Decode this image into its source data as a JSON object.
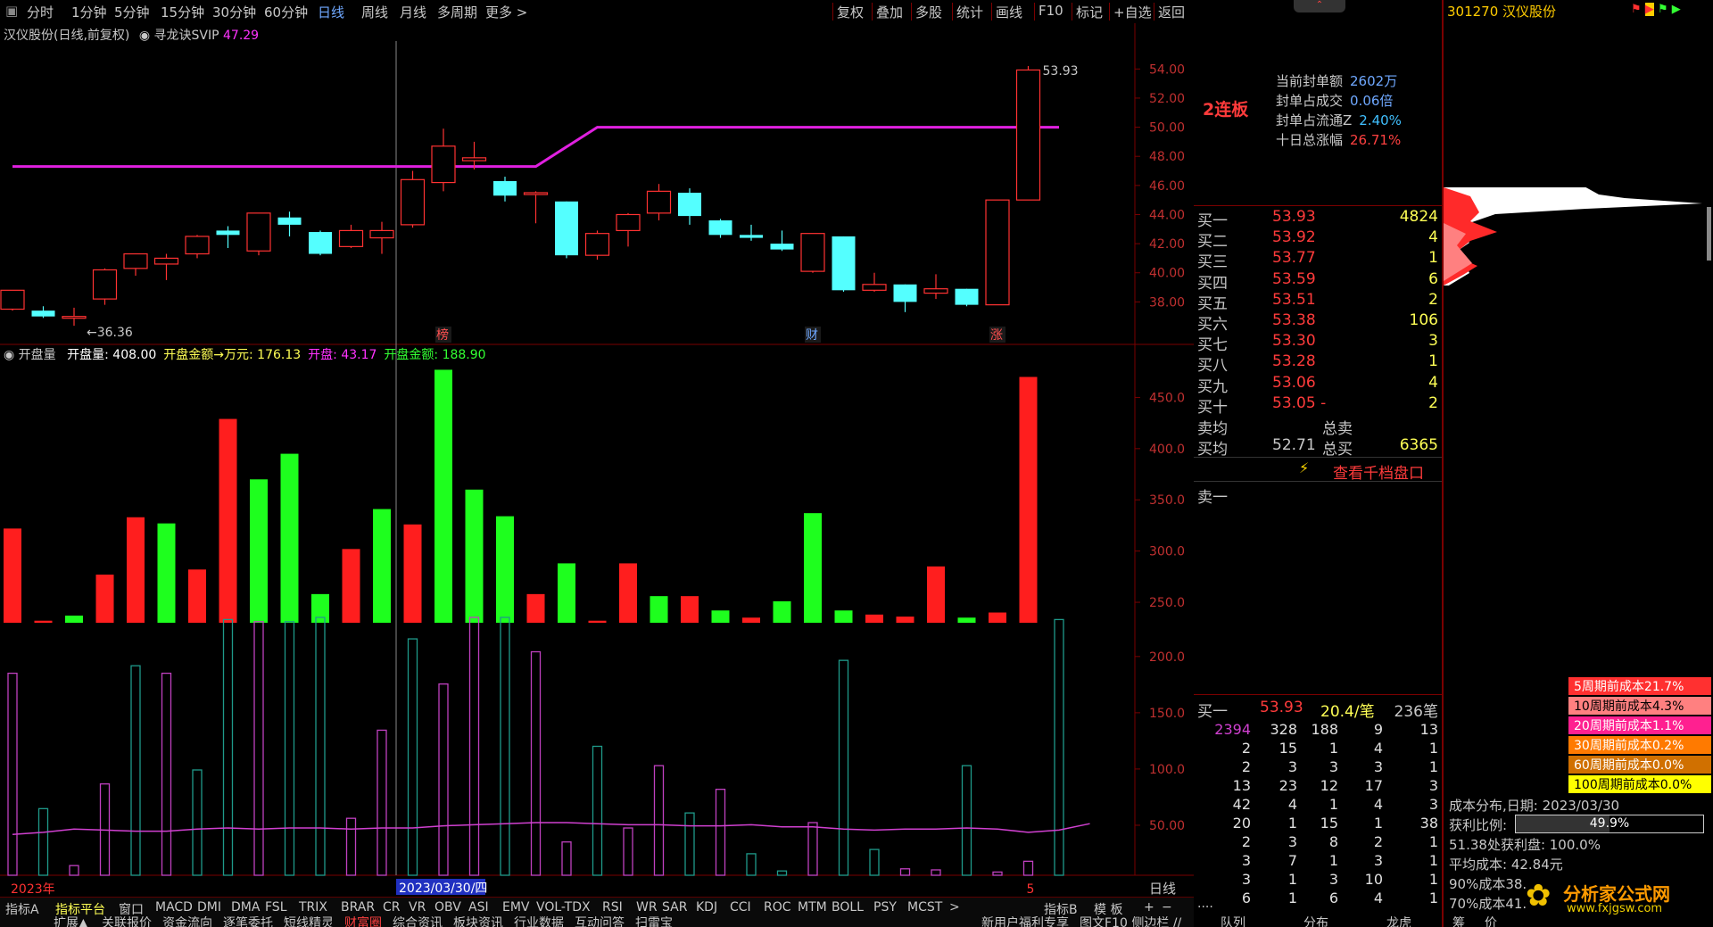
{
  "toolbar": {
    "periods": [
      "分时",
      "1分钟",
      "5分钟",
      "15分钟",
      "30分钟",
      "60分钟",
      "日线",
      "周线",
      "月线",
      "多周期",
      "更多 >"
    ],
    "active_period": "日线",
    "right_buttons": [
      "复权",
      "叠加",
      "多股",
      "统计",
      "画线",
      "F10",
      "标记",
      "+自选",
      "返回"
    ]
  },
  "stock": {
    "code": "301270",
    "name": "汉仪股份"
  },
  "chart_header": {
    "title": "汉仪股份(日线,前复权)",
    "indicator": "寻龙诀SVIP",
    "indicator_value": "47.29"
  },
  "price_axis": [
    "54.00",
    "52.00",
    "50.00",
    "48.00",
    "46.00",
    "44.00",
    "42.00",
    "40.00",
    "38.00"
  ],
  "price_labels": {
    "high": "53.93",
    "low": "36.36"
  },
  "event_markers": [
    {
      "label": "榜",
      "candle": 14
    },
    {
      "label": "财",
      "candle": 26
    },
    {
      "label": "涨",
      "candle": 32
    }
  ],
  "volume_header": {
    "name": "开盘量",
    "items": [
      {
        "label": "开盘量: 408.00",
        "color": "#ffffff"
      },
      {
        "label": "开盘金额→万元: 176.13",
        "color": "#ffff55"
      },
      {
        "label": "开盘: 43.17",
        "color": "#ff33ff"
      },
      {
        "label": "开盘金额: 188.90",
        "color": "#33ff33"
      }
    ]
  },
  "volume_axis": [
    "450.0",
    "400.0",
    "350.0",
    "300.0",
    "250.0",
    "200.0",
    "150.0",
    "100.0",
    "50.00"
  ],
  "date_axis": {
    "year": "2023年",
    "cursor_date": "2023/03/30/四",
    "last": "5",
    "period": "日线"
  },
  "indicator_tabs": [
    "指标A",
    "指标平台",
    "窗口",
    "MACD",
    "DMI",
    "DMA",
    "FSL",
    "TRIX",
    "BRAR",
    "CR",
    "VR",
    "OBV",
    "ASI",
    "EMV",
    "VOL-TDX",
    "RSI",
    "WR",
    "SAR",
    "KDJ",
    "CCI",
    "ROC",
    "MTM",
    "BOLL",
    "PSY",
    "MCST",
    ">",
    "指标B",
    "模 板",
    "+",
    "−"
  ],
  "bottom_tabs": [
    "扩展▲",
    "关联报价",
    "资金流向",
    "逐笔委托",
    "短线精灵",
    "财富圈",
    "综合资讯",
    "板块资讯",
    "行业数据",
    "互动问答",
    "扫雷宝",
    "新用户福利专享",
    "图文F10 侧边栏 //"
  ],
  "order_panel": {
    "limit_tag": "2连板",
    "stats": [
      {
        "label": "当前封单额",
        "value": "2602万"
      },
      {
        "label": "封单占成交",
        "value": "0.06倍"
      },
      {
        "label": "封单占流通Z",
        "value": "2.40%"
      },
      {
        "label": "十日总涨幅",
        "value": "26.71%"
      }
    ],
    "bids": [
      {
        "label": "买一",
        "price": "53.93",
        "vol": "4824"
      },
      {
        "label": "买二",
        "price": "53.92",
        "vol": "4"
      },
      {
        "label": "买三",
        "price": "53.77",
        "vol": "1"
      },
      {
        "label": "买四",
        "price": "53.59",
        "vol": "6"
      },
      {
        "label": "买五",
        "price": "53.51",
        "vol": "2"
      },
      {
        "label": "买六",
        "price": "53.38",
        "vol": "106"
      },
      {
        "label": "买七",
        "price": "53.30",
        "vol": "3"
      },
      {
        "label": "买八",
        "price": "53.28",
        "vol": "1"
      },
      {
        "label": "买九",
        "price": "53.06",
        "vol": "4"
      },
      {
        "label": "买十",
        "price": "53.05 -",
        "vol": "2"
      }
    ],
    "sell_avg_label": "卖均",
    "sell_total_label": "总卖",
    "buy_avg_label": "买均",
    "buy_avg": "52.71",
    "buy_total_label": "总买",
    "buy_total": "6365",
    "thousand_link": "查看千档盘口",
    "sell_one": "卖一",
    "queue_header": {
      "label": "买一",
      "price": "53.93",
      "per": "20.4/笔",
      "count": "236笔"
    },
    "queue": [
      [
        "2394",
        "328",
        "188",
        "9",
        "13"
      ],
      [
        "2",
        "15",
        "1",
        "4",
        "1"
      ],
      [
        "2",
        "3",
        "3",
        "3",
        "1"
      ],
      [
        "13",
        "23",
        "12",
        "17",
        "3"
      ],
      [
        "42",
        "4",
        "1",
        "4",
        "3"
      ],
      [
        "20",
        "1",
        "15",
        "1",
        "38"
      ],
      [
        "2",
        "3",
        "8",
        "2",
        "1"
      ],
      [
        "3",
        "7",
        "1",
        "3",
        "1"
      ],
      [
        "3",
        "1",
        "3",
        "10",
        "1"
      ],
      [
        "6",
        "1",
        "6",
        "4",
        "1"
      ]
    ],
    "ellipsis": "....",
    "bottom_tabs": [
      "队列",
      "分布",
      "龙虎"
    ]
  },
  "cost_panel": {
    "legend": [
      {
        "label": "5周期前成本21.7%",
        "color": "#ff3030"
      },
      {
        "label": "10周期前成本4.3%",
        "color": "#ff8080"
      },
      {
        "label": "20周期前成本1.1%",
        "color": "#ff2090"
      },
      {
        "label": "30周期前成本0.2%",
        "color": "#ff7a00"
      },
      {
        "label": "60周期前成本0.0%",
        "color": "#d07000"
      },
      {
        "label": "100周期前成本0.0%",
        "color": "#ffff00"
      }
    ],
    "date_label": "成本分布,日期:",
    "date": "2023/03/30",
    "profit_label": "获利比例:",
    "profit": "49.9%",
    "profit_fraction": 0.499,
    "profit_at": "51.38处获利盘: 100.0%",
    "avg_cost": "平均成本: 42.84元",
    "cost90": "90%成本38.",
    "cost70": "70%成本41.",
    "bottom_tabs": [
      "筹",
      "价"
    ],
    "watermark_title": "分析家公式网",
    "watermark_url": "www.fxjgsw.com"
  },
  "chart_data": {
    "type": "candlestick",
    "price_ylim": [
      36,
      55
    ],
    "candles": [
      {
        "o": 37.5,
        "h": 38.8,
        "l": 37.4,
        "c": 38.8
      },
      {
        "o": 37.4,
        "h": 37.7,
        "l": 36.9,
        "c": 37.0
      },
      {
        "o": 37.0,
        "h": 37.6,
        "l": 36.36,
        "c": 37.0
      },
      {
        "o": 38.2,
        "h": 40.3,
        "l": 37.8,
        "c": 40.2
      },
      {
        "o": 40.3,
        "h": 41.3,
        "l": 39.8,
        "c": 41.3
      },
      {
        "o": 40.6,
        "h": 41.3,
        "l": 39.5,
        "c": 41.0
      },
      {
        "o": 41.3,
        "h": 42.6,
        "l": 41.0,
        "c": 42.5
      },
      {
        "o": 42.9,
        "h": 43.2,
        "l": 41.7,
        "c": 42.6
      },
      {
        "o": 41.5,
        "h": 44.1,
        "l": 41.2,
        "c": 44.1
      },
      {
        "o": 43.8,
        "h": 44.2,
        "l": 42.5,
        "c": 43.3
      },
      {
        "o": 42.8,
        "h": 42.9,
        "l": 41.2,
        "c": 41.3
      },
      {
        "o": 41.8,
        "h": 43.3,
        "l": 41.7,
        "c": 42.9
      },
      {
        "o": 42.4,
        "h": 43.5,
        "l": 41.3,
        "c": 42.9
      },
      {
        "o": 43.3,
        "h": 47.0,
        "l": 43.1,
        "c": 46.4
      },
      {
        "o": 46.2,
        "h": 49.9,
        "l": 45.6,
        "c": 48.7
      },
      {
        "o": 47.7,
        "h": 49.0,
        "l": 47.1,
        "c": 47.9
      },
      {
        "o": 46.3,
        "h": 46.6,
        "l": 44.9,
        "c": 45.3
      },
      {
        "o": 45.5,
        "h": 45.6,
        "l": 43.4,
        "c": 45.5
      },
      {
        "o": 44.9,
        "h": 44.9,
        "l": 41.0,
        "c": 41.2
      },
      {
        "o": 41.2,
        "h": 42.9,
        "l": 40.9,
        "c": 42.7
      },
      {
        "o": 42.9,
        "h": 44.1,
        "l": 41.8,
        "c": 44.0
      },
      {
        "o": 44.1,
        "h": 46.1,
        "l": 43.6,
        "c": 45.6
      },
      {
        "o": 45.5,
        "h": 45.8,
        "l": 43.3,
        "c": 43.9
      },
      {
        "o": 43.6,
        "h": 43.7,
        "l": 42.4,
        "c": 42.6
      },
      {
        "o": 42.6,
        "h": 43.3,
        "l": 42.2,
        "c": 42.4
      },
      {
        "o": 42.0,
        "h": 42.9,
        "l": 41.5,
        "c": 41.6
      },
      {
        "o": 40.1,
        "h": 42.7,
        "l": 40.0,
        "c": 42.7
      },
      {
        "o": 42.5,
        "h": 42.5,
        "l": 38.7,
        "c": 38.8
      },
      {
        "o": 38.8,
        "h": 40.0,
        "l": 38.7,
        "c": 39.2
      },
      {
        "o": 39.2,
        "h": 39.2,
        "l": 37.3,
        "c": 38.0
      },
      {
        "o": 38.6,
        "h": 39.9,
        "l": 38.2,
        "c": 38.9
      },
      {
        "o": 38.9,
        "h": 38.9,
        "l": 37.7,
        "c": 37.8
      },
      {
        "o": 37.8,
        "h": 45.0,
        "l": 37.8,
        "c": 45.0
      },
      {
        "o": 45.0,
        "h": 54.2,
        "l": 45.0,
        "c": 53.93
      }
    ],
    "line": {
      "color": "#e020e0",
      "segments": [
        [
          0,
          47.3
        ],
        [
          17,
          47.3
        ],
        [
          19,
          50.0
        ],
        [
          34,
          50.0
        ]
      ]
    },
    "volume_ylim": [
      230,
      480
    ],
    "volume_bars": [
      {
        "v": 322,
        "color": "red"
      },
      {
        "v": 232,
        "color": "red"
      },
      {
        "v": 237,
        "color": "green"
      },
      {
        "v": 277,
        "color": "red"
      },
      {
        "v": 333,
        "color": "red"
      },
      {
        "v": 327,
        "color": "green"
      },
      {
        "v": 282,
        "color": "red"
      },
      {
        "v": 429,
        "color": "red"
      },
      {
        "v": 370,
        "color": "green"
      },
      {
        "v": 395,
        "color": "green"
      },
      {
        "v": 258,
        "color": "green"
      },
      {
        "v": 302,
        "color": "red"
      },
      {
        "v": 341,
        "color": "green"
      },
      {
        "v": 326,
        "color": "red"
      },
      {
        "v": 477,
        "color": "green"
      },
      {
        "v": 360,
        "color": "green"
      },
      {
        "v": 334,
        "color": "green"
      },
      {
        "v": 258,
        "color": "red"
      },
      {
        "v": 288,
        "color": "green"
      },
      {
        "v": 232,
        "color": "red"
      },
      {
        "v": 288,
        "color": "red"
      },
      {
        "v": 256,
        "color": "green"
      },
      {
        "v": 256,
        "color": "red"
      },
      {
        "v": 242,
        "color": "green"
      },
      {
        "v": 235,
        "color": "red"
      },
      {
        "v": 251,
        "color": "green"
      },
      {
        "v": 337,
        "color": "green"
      },
      {
        "v": 242,
        "color": "green"
      },
      {
        "v": 238,
        "color": "red"
      },
      {
        "v": 236,
        "color": "red"
      },
      {
        "v": 285,
        "color": "red"
      },
      {
        "v": 235,
        "color": "green"
      },
      {
        "v": 240,
        "color": "red"
      },
      {
        "v": 470,
        "color": "red"
      }
    ],
    "lower_ylim": [
      0,
      235
    ],
    "lower_bars": [
      188,
      62,
      9,
      85,
      195,
      188,
      98,
      238,
      236,
      236,
      240,
      53,
      135,
      220,
      178,
      240,
      240,
      208,
      31,
      120,
      44,
      102,
      58,
      80,
      20,
      4,
      49,
      200,
      24,
      6,
      5,
      102,
      3,
      13,
      238
    ],
    "lower_line": [
      38,
      40,
      43,
      42,
      41,
      41,
      43,
      44,
      43,
      44,
      44,
      43,
      44,
      44,
      46,
      47,
      48,
      49,
      49,
      48,
      47,
      47,
      46,
      46,
      47,
      45,
      45,
      43,
      42,
      43,
      43,
      44,
      43,
      40,
      42,
      48
    ]
  }
}
